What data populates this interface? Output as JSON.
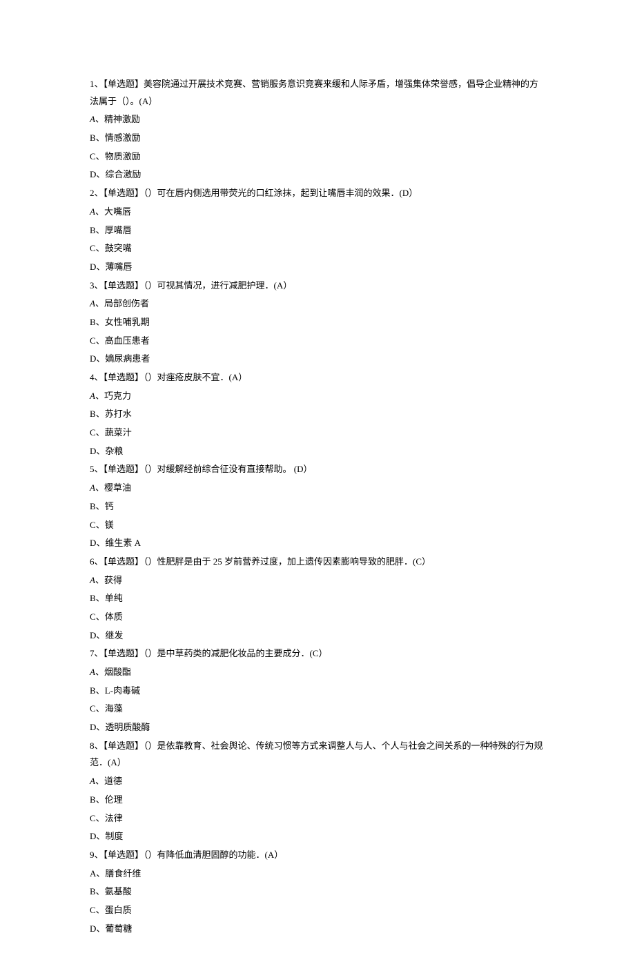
{
  "questions": [
    {
      "number": "1",
      "type": "【单选题】",
      "stem": "美容院通过开展技术竞赛、营销服务意识竞赛来缓和人际矛盾，增强集体荣誉感，倡导企业精神的方法属于（）。(A）",
      "options": [
        {
          "label": "A",
          "text": "精神激励",
          "italic": true
        },
        {
          "label": "B",
          "text": "情感激励"
        },
        {
          "label": "C",
          "text": "物质激励"
        },
        {
          "label": "D",
          "text": "综合激励"
        }
      ]
    },
    {
      "number": "2",
      "type": "【单选题】",
      "stem": "（）可在唇内侧选用带荧光的口红涂抹，起到让嘴唇丰润的效果．(D）",
      "options": [
        {
          "label": "A",
          "text": "大嘴唇",
          "italic": true
        },
        {
          "label": "B",
          "text": "厚嘴唇"
        },
        {
          "label": "C",
          "text": "鼓突嘴"
        },
        {
          "label": "D",
          "text": "薄嘴唇"
        }
      ]
    },
    {
      "number": "3",
      "type": "【单选题】",
      "stem": "（）可视其情况，进行减肥护理．(A）",
      "options": [
        {
          "label": "A",
          "text": "局部创伤者",
          "italic": true
        },
        {
          "label": "B",
          "text": "女性哺乳期"
        },
        {
          "label": "C",
          "text": "高血压患者"
        },
        {
          "label": "D",
          "text": "嫡尿病患者"
        }
      ]
    },
    {
      "number": "4",
      "type": "【单选题】",
      "stem": "（）对痤疮皮肤不宜．(A）",
      "options": [
        {
          "label": "A",
          "text": "巧克力",
          "italic": true
        },
        {
          "label": "B",
          "text": "苏打水"
        },
        {
          "label": "C",
          "text": "蔬菜汁"
        },
        {
          "label": "D",
          "text": "杂粮"
        }
      ]
    },
    {
      "number": "5",
      "type": "【单选题】",
      "stem": "（）对缓解经前综合征没有直接帮助。  (D）",
      "options": [
        {
          "label": "A",
          "text": "樱草油",
          "italic": true
        },
        {
          "label": "B",
          "text": "钙"
        },
        {
          "label": "C",
          "text": "镁"
        },
        {
          "label": "D",
          "text": "维生素 A"
        }
      ]
    },
    {
      "number": "6",
      "type": "【单选题】",
      "stem": "（）性肥胖是由于 25 岁前营养过度，加上遗传因素膨响导致的肥胖．(C）",
      "options": [
        {
          "label": "A",
          "text": "获得",
          "italic": true
        },
        {
          "label": "B",
          "text": "单纯"
        },
        {
          "label": "C",
          "text": "体质"
        },
        {
          "label": "D",
          "text": "继发"
        }
      ]
    },
    {
      "number": "7",
      "type": "【单选题】",
      "stem": "（）是中草药类的减肥化妆品的主要成分．(C）",
      "options": [
        {
          "label": "A",
          "text": "烟酸酯",
          "italic": true
        },
        {
          "label": "B",
          "text": "L-肉毒碱"
        },
        {
          "label": "C",
          "text": "海藻"
        },
        {
          "label": "D",
          "text": "透明质酸酶"
        }
      ]
    },
    {
      "number": "8",
      "type": "【单选题】",
      "stem": "（）是依靠教育、社会舆论、传统习惯等方式来调整人与人、个人与社会之间关系的一种特殊的行为规范．(A）",
      "options": [
        {
          "label": "A",
          "text": "道德",
          "italic": true
        },
        {
          "label": "B",
          "text": "伦理"
        },
        {
          "label": "C",
          "text": "法律"
        },
        {
          "label": "D",
          "text": "制度"
        }
      ]
    },
    {
      "number": "9",
      "type": "【单选题】",
      "stem": "（）有降低血清胆固醇的功能．(A）",
      "options": [
        {
          "label": "A",
          "text": "膳食纤维"
        },
        {
          "label": "B",
          "text": "氨基酸"
        },
        {
          "label": "C",
          "text": "蛋白质"
        },
        {
          "label": "D",
          "text": "葡萄糖"
        }
      ]
    }
  ]
}
